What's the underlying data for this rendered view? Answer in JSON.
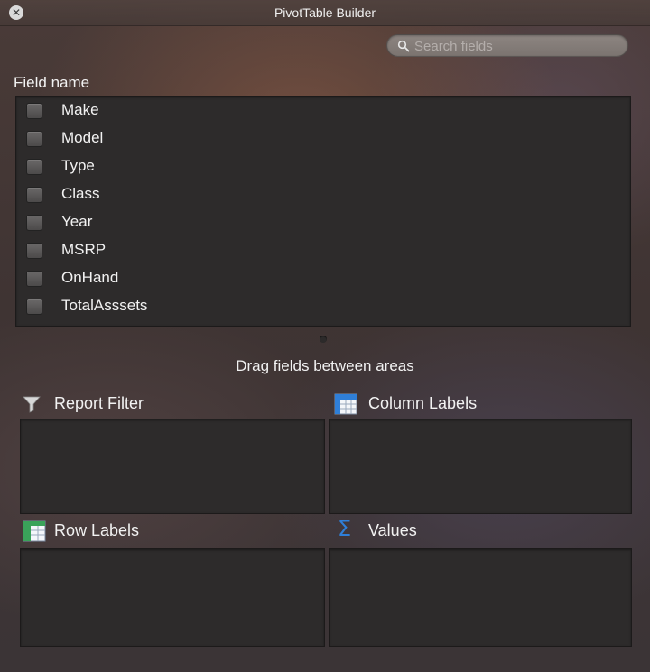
{
  "window": {
    "title": "PivotTable Builder",
    "close_glyph": "✕"
  },
  "search": {
    "placeholder": "Search fields",
    "value": "",
    "icon": "magnifier-icon"
  },
  "fields": {
    "header": "Field name",
    "items": [
      {
        "label": "Make",
        "checked": false
      },
      {
        "label": "Model",
        "checked": false
      },
      {
        "label": "Type",
        "checked": false
      },
      {
        "label": "Class",
        "checked": false
      },
      {
        "label": "Year",
        "checked": false
      },
      {
        "label": "MSRP",
        "checked": false
      },
      {
        "label": "OnHand",
        "checked": false
      },
      {
        "label": "TotalAsssets",
        "checked": false
      }
    ]
  },
  "drag_hint": "Drag fields between areas",
  "areas": {
    "report_filter": {
      "label": "Report Filter",
      "icon": "filter-icon"
    },
    "column_labels": {
      "label": "Column Labels",
      "icon": "column-labels-icon"
    },
    "row_labels": {
      "label": "Row Labels",
      "icon": "row-labels-icon"
    },
    "values": {
      "label": "Values",
      "icon": "sigma-icon",
      "glyph": "Σ"
    }
  },
  "colors": {
    "accent_blue": "#2f7fd8",
    "panel": "#2d2b2b",
    "text": "#f2f2f2"
  }
}
